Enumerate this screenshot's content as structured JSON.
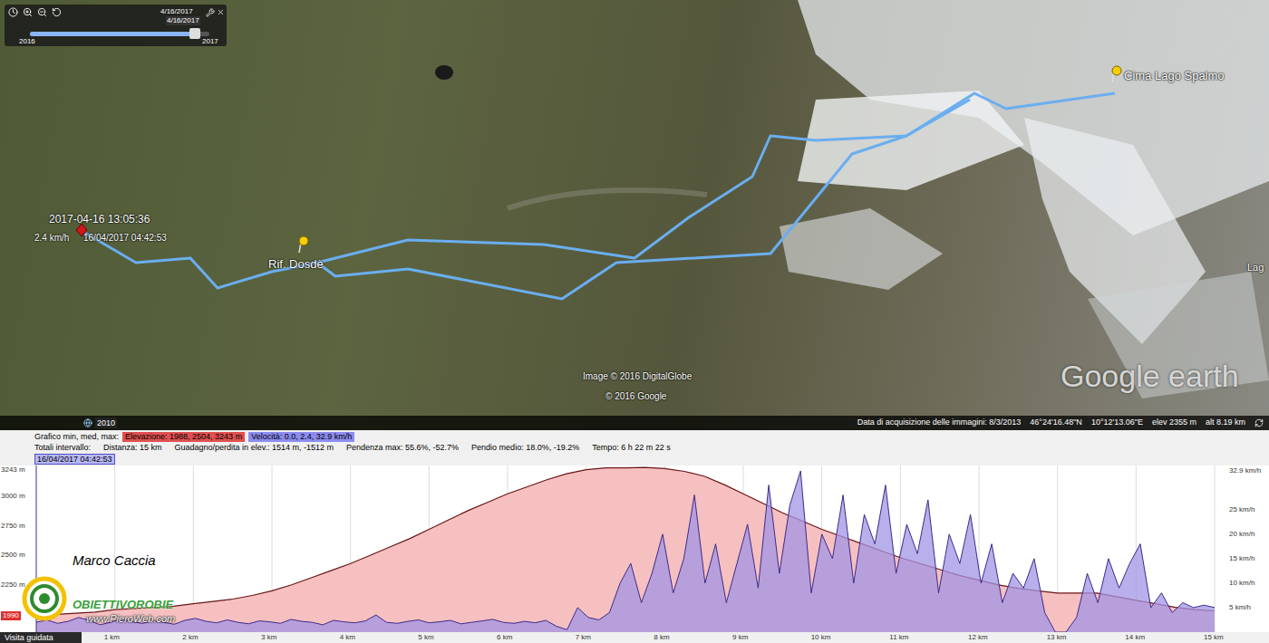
{
  "toolbar": {
    "date": "4/16/2017",
    "tooltip": "4/16/2017",
    "start_year": "2016",
    "end_year": "2017",
    "level": 0.95
  },
  "map": {
    "image_credit": "Image © 2016 DigitalGlobe",
    "copyright": "© 2016 Google",
    "logo": "Google earth",
    "edge_label": "Lag",
    "placemarks": [
      {
        "name": "Cima Lago Spalmo"
      },
      {
        "name": "Rif. Dosdè"
      }
    ],
    "track_start": {
      "time": "2017-04-16 13:05:36",
      "speed": "2.4 km/h",
      "date": "16/04/2017 04:42:53"
    }
  },
  "status_bar": {
    "year": "2010",
    "acquisition": "Data di acquisizione delle immagini: 8/3/2013",
    "lat": "46°24'16.48\"N",
    "lon": "10°12'13.06\"E",
    "elev": "elev 2355 m",
    "alt": "alt 8.19 km"
  },
  "chart": {
    "header_row1": {
      "label": "Grafico min, med, max:",
      "elevation": "Elevazione: 1988, 2504, 3243 m",
      "speed": "Velocità: 0.0, 2.4, 32.9 km/h"
    },
    "header_row2": [
      "Totali intervallo:",
      "Distanza: 15 km",
      "Guadagno/perdita in elev.: 1514 m, -1512 m",
      "Pendenza max: 55.6%, -52.7%",
      "Pendio medio: 18.0%, -19.2%",
      "Tempo: 6 h 22 m 22 s"
    ],
    "cursor_time": "16/04/2017 04:42:53",
    "left_ticks": [
      {
        "label": "3243 m",
        "value": 3243,
        "highlighted": false
      },
      {
        "label": "3000 m",
        "value": 3000,
        "highlighted": false
      },
      {
        "label": "2750 m",
        "value": 2750,
        "highlighted": false
      },
      {
        "label": "2500 m",
        "value": 2500,
        "highlighted": false
      },
      {
        "label": "2250 m",
        "value": 2250,
        "highlighted": false
      },
      {
        "label": "1990",
        "value": 1990,
        "highlighted": true
      }
    ],
    "right_ticks": [
      {
        "label": "32.9 km/h",
        "value": 32.9
      },
      {
        "label": "25 km/h",
        "value": 25
      },
      {
        "label": "20 km/h",
        "value": 20
      },
      {
        "label": "15 km/h",
        "value": 15
      },
      {
        "label": "10 km/h",
        "value": 10
      },
      {
        "label": "5 km/h",
        "value": 5
      }
    ],
    "x_ticks": [
      {
        "label": "1 km",
        "km": 1
      },
      {
        "label": "2 km",
        "km": 2
      },
      {
        "label": "3 km",
        "km": 3
      },
      {
        "label": "4 km",
        "km": 4
      },
      {
        "label": "5 km",
        "km": 5
      },
      {
        "label": "6 km",
        "km": 6
      },
      {
        "label": "7 km",
        "km": 7
      },
      {
        "label": "8 km",
        "km": 8
      },
      {
        "label": "9 km",
        "km": 9
      },
      {
        "label": "10 km",
        "km": 10
      },
      {
        "label": "11 km",
        "km": 11
      },
      {
        "label": "12 km",
        "km": 12
      },
      {
        "label": "13 km",
        "km": 13
      },
      {
        "label": "14 km",
        "km": 14
      },
      {
        "label": "15 km",
        "km": 15
      }
    ],
    "elevation": [
      1988,
      2000,
      2010,
      2020,
      2040,
      2050,
      2060,
      2070,
      2090,
      2110,
      2130,
      2160,
      2200,
      2250,
      2310,
      2370,
      2430,
      2500,
      2570,
      2640,
      2720,
      2800,
      2880,
      2950,
      3020,
      3080,
      3140,
      3190,
      3225,
      3240,
      3240,
      3243,
      3235,
      3210,
      3170,
      3100,
      3020,
      2940,
      2860,
      2790,
      2720,
      2660,
      2600,
      2540,
      2480,
      2430,
      2380,
      2330,
      2290,
      2250,
      2220,
      2200,
      2180,
      2180,
      2180,
      2150,
      2120,
      2090,
      2060,
      2040,
      2030
    ],
    "speed": [
      2,
      2.5,
      1.8,
      2.2,
      3,
      2.4,
      1.5,
      2,
      2.6,
      2.1,
      1.8,
      2.3,
      2,
      1.6,
      2.4,
      2.8,
      2.2,
      1.9,
      2.5,
      2,
      1.7,
      2.3,
      2.1,
      1.8,
      2.6,
      2.2,
      2,
      1.5,
      2.4,
      2.1,
      1.9,
      2.3,
      3.5,
      2,
      1.8,
      2.2,
      2.5,
      1.9,
      2.1,
      2.4,
      1.7,
      2,
      2.3,
      2.6,
      2,
      1.8,
      2.2,
      1.9,
      2.4,
      1.2,
      0.5,
      5,
      3,
      2.5,
      4,
      10,
      14,
      6,
      12,
      20,
      8,
      15,
      28,
      10,
      18,
      6,
      14,
      22,
      9,
      30,
      12,
      26,
      32.9,
      8,
      20,
      15,
      28,
      10,
      24,
      18,
      30,
      12,
      22,
      16,
      27,
      8,
      20,
      14,
      24,
      10,
      18,
      6,
      12,
      9,
      15,
      4,
      0,
      0,
      3,
      12,
      6,
      15,
      9,
      14,
      18,
      5,
      8,
      4,
      6,
      5,
      5.5,
      5
    ]
  },
  "watermark": {
    "author": "Marco Caccia",
    "site": "OBIETTIVOROBIE",
    "url": "www.PieroWeb.com"
  },
  "footer_button": "Visita guidata"
}
